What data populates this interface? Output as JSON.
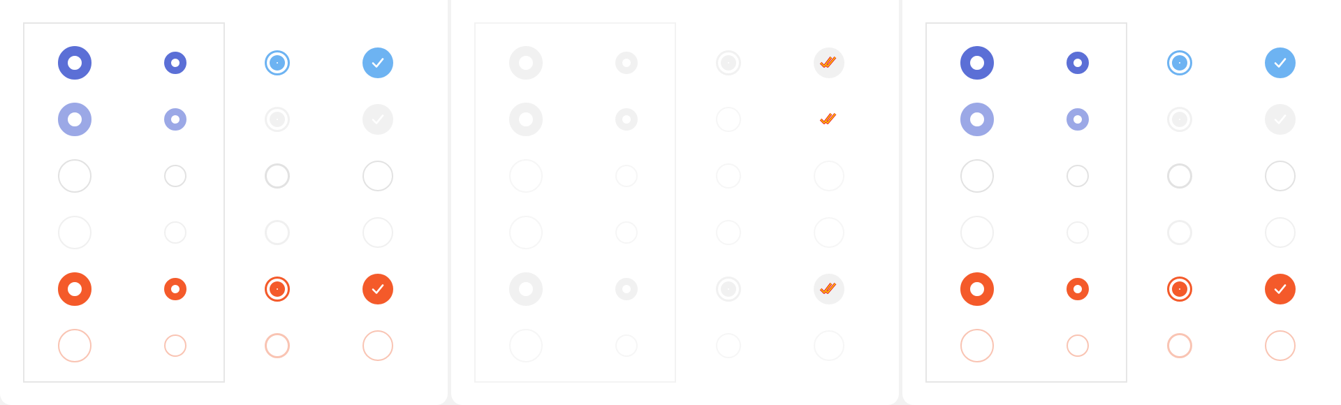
{
  "colors": {
    "indigo": "#5b6fd6",
    "indigo_light": "#9ba8e6",
    "sky": "#6db3f2",
    "orange": "#f45a2a",
    "orange_light": "#f9c4b3",
    "gray_border": "#e2e2e2",
    "gray_faint": "#f0f0f0",
    "gray_fill": "#f1f1f1",
    "error_red": "#e8202a",
    "error_yellow": "#ffd400"
  },
  "icons": {
    "check": "checkmark-icon",
    "double_check": "double-checkmark-icon"
  },
  "panels": [
    {
      "id": "left",
      "state": "normal"
    },
    {
      "id": "middle",
      "state": "disabled"
    },
    {
      "id": "right",
      "state": "normal"
    }
  ]
}
